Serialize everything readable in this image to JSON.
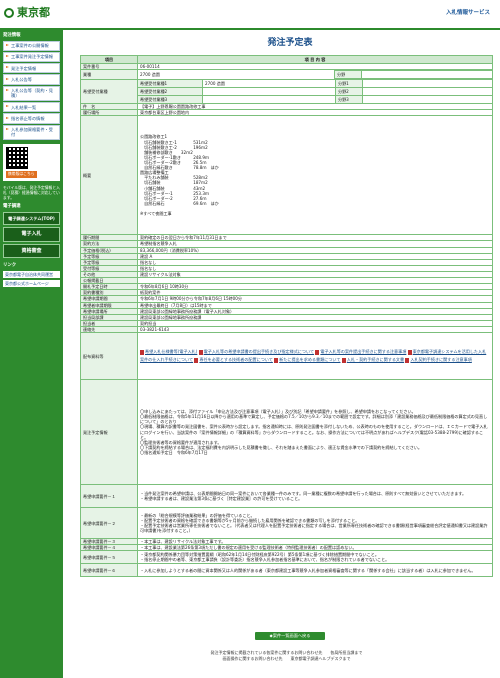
{
  "header": {
    "logo_text": "東京都",
    "site_title": "入札情報サービス"
  },
  "sidebar": {
    "section1": "発注情報",
    "items": [
      "工事案件の公開情報",
      "工事案件発注予定情報",
      "発注予定情報",
      "入札公告等",
      "入札公告等（契約・見積）",
      "入札結果一覧",
      "指名停止等の情報",
      "入札参加資格要件・受付"
    ],
    "qr_badge": "携帯版はこちら",
    "qr_text": "モバイル版は、発注予定情報と入札（見積）経過情報に対応しています。",
    "section2": "電子調達",
    "btn_system": "電子調達システム(TOP)",
    "btn_bid": "電子入札",
    "btn_qual": "資格審査",
    "section3": "リンク",
    "links": [
      "東京都電子自治体共同運営",
      "東京都公式ホームページ"
    ]
  },
  "page": {
    "title": "発注予定表"
  },
  "table": {
    "col_item": "項目",
    "col_content": "項 目 内 容",
    "rows": {
      "no": {
        "label": "案件番号",
        "value": "06-00114"
      },
      "type": {
        "label": "業種",
        "value": "2700 造園",
        "sub": "分野"
      },
      "desired": {
        "label": "希望受付業種",
        "r1l": "希望受付業種1",
        "r1v": "2700 造園",
        "r2l": "希望受付業種2",
        "r3l": "希望受付業種3",
        "s1": "分野1",
        "s2": "分野2",
        "s3": "分野3"
      },
      "name": {
        "label": "件　名",
        "value": "【電子】上野恩賜公園園路改修工事"
      },
      "place": {
        "label": "履行場所",
        "value": "東京都台東区上野公園地内"
      },
      "summary": {
        "label": "概要",
        "value": "公園路改修工1\n　切石舗装敷き工-1　　　　531ｍ2\n　切石舗装敷き工-2　　　　196ｍ2\n　舗装補修部敷き　　32ｍ2\n　切石ボーダー-1敷き　　　248.9ｍ\n　切石ボーダー-2敷き　　　26.5ｍ\n　自然石縁石敷き　　　　　78.8ｍ　ほか\n園路広場整備工\n　平たわみ舗装　　　　　　528ｍ2\n　切石舗装　　　　　　　　187ｍ2\n　小舗石舗装　　　　　　　43ｍ2\n　切石ボーダー-1　　　　　253.3ｍ\n　切石ボーダー-2　　　　　27.6ｍ\n　自然石縁石　　　　　　　69.6ｍ　ほか\n\n※すべて夜間工事"
      },
      "period": {
        "label": "履行期間",
        "value": "契約確定の日の翌日から令和7年11月31日まで"
      },
      "method": {
        "label": "契約方法",
        "value": "希望制指名競争入札"
      },
      "price": {
        "label": "予定価格(税込)",
        "value": "83,366,000円（消費税率10%）"
      },
      "rank": {
        "label": "予定等級",
        "value": "建設 A"
      },
      "ranking": {
        "label": "予定等級",
        "value": "指名なし"
      },
      "contract": {
        "label": "受付等級",
        "value": "指名なし"
      },
      "other": {
        "label": "その他",
        "value": "建設リサイクル法対象"
      },
      "pub": {
        "label": "公報掲載日",
        "value": ""
      },
      "open": {
        "label": "開札予定日時",
        "value": "令和6年8月6日 10時30分"
      },
      "spec": {
        "label": "契約書種別",
        "value": "紙契約案件"
      },
      "app_period": {
        "label": "希望申請期間",
        "value": "令和6年7月1日 9時00分から令和7年8月6日 15時00分"
      },
      "app_deadline": {
        "label": "希望者申請期限",
        "value": "希望申出最終日（7月8日）は15時まで"
      },
      "where": {
        "label": "希望申請場所",
        "value": "建設局東部公園緑地事務所庶務課（電子入札対象）"
      },
      "section": {
        "label": "担当局部課",
        "value": "建設局東部公園緑地事務所庶務課"
      },
      "person": {
        "label": "担当者",
        "value": "契約担当"
      },
      "tel": {
        "label": "連絡先",
        "value": "03-3821-6143"
      },
      "docs": {
        "label": "配布資料等",
        "items": [
          "希望入札仕様書等(電子入札)",
          "電子入札等の希望申請書の提出手続き及び指定様式について",
          "電子入札等の案件提出手続きに関する注意事項",
          "東京都電子調達システムを活用した入札案件の仕入れ手続きについて",
          "専任を必要とする技術者の配置について",
          "新たに提出を求める書類について",
          "入札・契約手続きに関する文書",
          "入札契約手続きに関する注意事項"
        ]
      },
      "order": {
        "label": "発注予定情報",
        "value": "〇申し込みにあたっては、添付ファイル「申込方法及び注意事項（電子入札）」及び別記「希望申請要件」を参照し、希望申請をおこなってください。\n〇最低制限価格は、令和5年11月16日以降から適用の基準で算定し、予定価格の7.5／10から9.3／10までの範囲で設定です。詳細は別添「建設業務価格及び最低制限価格の算定式の見直しについて」のとおり\n〇現場、積算内訳書等の発注図書を、案件公表時から設定します。指名通知時には、原則発注図書を添付しないため、公表時のものを使用すること。ダウンロードは、ＩＣカードで電子入札にログインを行い、当該案件の「案件情報詳細」の「積算資料等」からダウンロードすること。なお、操作方法については不明点があればヘルプデスク(電話03-5388-2799)に確認すること。\n〇監理技術者等の資格要件が適用されます。\n〇下請契約を締結する場合は、法定福利費を内訳明示した見積書を徴し、それを踏まえた書面により、適正な賃金水準での下請契約を締結してください。\n〇指名通知予定日　令和6年7月17日"
      },
      "req1": {
        "label": "希望申請要件－１",
        "value": "・当件発注案件の希望申請は、公表期間開始日の同一案件において各業種一件のみです。同一業種に複数の希望申請を行った場合は、原則すべて無効扱いとさせていただきます。\n・希望申請する者は、建設業法第3条に基づく［特定建設業］の許可を受けていること。"
      },
      "req2": {
        "label": "希望申請要件－２",
        "value": "・最新の「総合規模等評価業務結果」の評価を得ていること。\n・配置予定技術者の資格を確認できる書類等が5ヶ月前から継続した雇用関係を確認できる書類の写しを添付すること。\n・配置予定技術者は営業所専任技術者でないこと。（代表者又は代理人を配置予定技術者に指定する場合は、営業所専任技術者の確認できる書類(経営事項審査総合評定値通知書又は建設業許可申請書)を添付すること。）"
      },
      "req3": {
        "label": "希望申請要件－３",
        "value": "・本工事は、建設リサイクル法対象工事です。"
      },
      "req4": {
        "label": "希望申請要件－４",
        "value": "・本工事は、建設業法第26条第3項ただし書の規定の適用を受ける監理技術者（特例監理技術者）の配置は認めない。"
      },
      "req5": {
        "label": "希望申請要件－５",
        "value": "・東京都契約関係暴力団等対策措置要綱（昭和62年1月14日付財経庶第922号）第5条第1項に基づく排除措置期間中でないこと。\n・指名停止期間中の者等、東京都工事請負（設計等委託）指名競争入札参加者指名基準において、指名が制限されている者でないこと。"
      },
      "req6": {
        "label": "希望申請要件－６",
        "value": "・入札に参加しようとする者の間に資本関係又は人的関係がある者（東京都建設工事等競争入札参加者資格審査等に関する「関係する会社」に該当する者）は入札に参加できません。"
      }
    }
  },
  "back_button": "◆案件一覧画面へ戻る",
  "footer": {
    "line1": "発注予定情報に掲載されている各案件に関するお問い合わせ先　　各局所担当課まで",
    "line2": "画面操作に関するお問い合わせ先　　東京都電子調達ヘルプデスクまで"
  }
}
